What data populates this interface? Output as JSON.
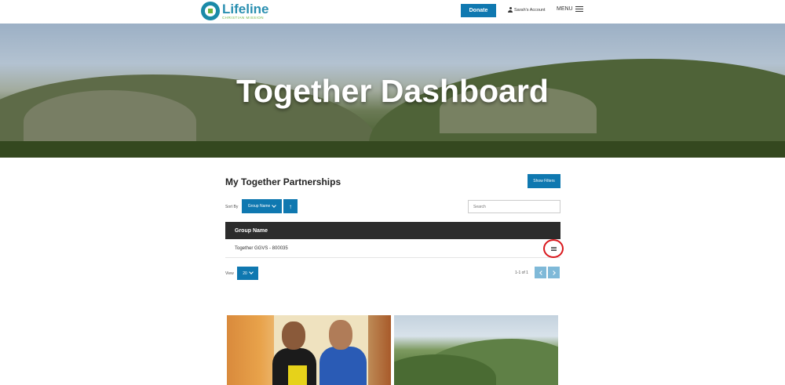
{
  "header": {
    "logo_name": "Lifeline",
    "logo_sub": "CHRISTIAN MISSION",
    "donate_label": "Donate",
    "account_label": "Sarah's Account",
    "menu_label": "MENU"
  },
  "hero": {
    "title": "Together Dashboard"
  },
  "partnerships": {
    "title": "My Together Partnerships",
    "filters_label": "Show Filters",
    "sort_label": "Sort By",
    "sort_value": "Group Name",
    "sort_direction": "↑",
    "search_placeholder": "Search",
    "table": {
      "columns": [
        "Group Name"
      ],
      "rows": [
        {
          "group_name": "Together GGVS - 800035"
        }
      ]
    },
    "view_label": "View",
    "view_value": "20",
    "pager_text": "1-1 of 1"
  },
  "colors": {
    "accent": "#0f78b0",
    "table_header": "#2c2c2c",
    "highlight_circle": "#d9171c",
    "pager_disabled": "#7fb9d8"
  },
  "icons": {
    "account": "user-icon",
    "menu": "hamburger-icon",
    "row_actions": "hamburger-icon",
    "sort_dropdown": "chevron-down-icon",
    "pager_prev": "chevron-left-icon",
    "pager_next": "chevron-right-icon"
  }
}
